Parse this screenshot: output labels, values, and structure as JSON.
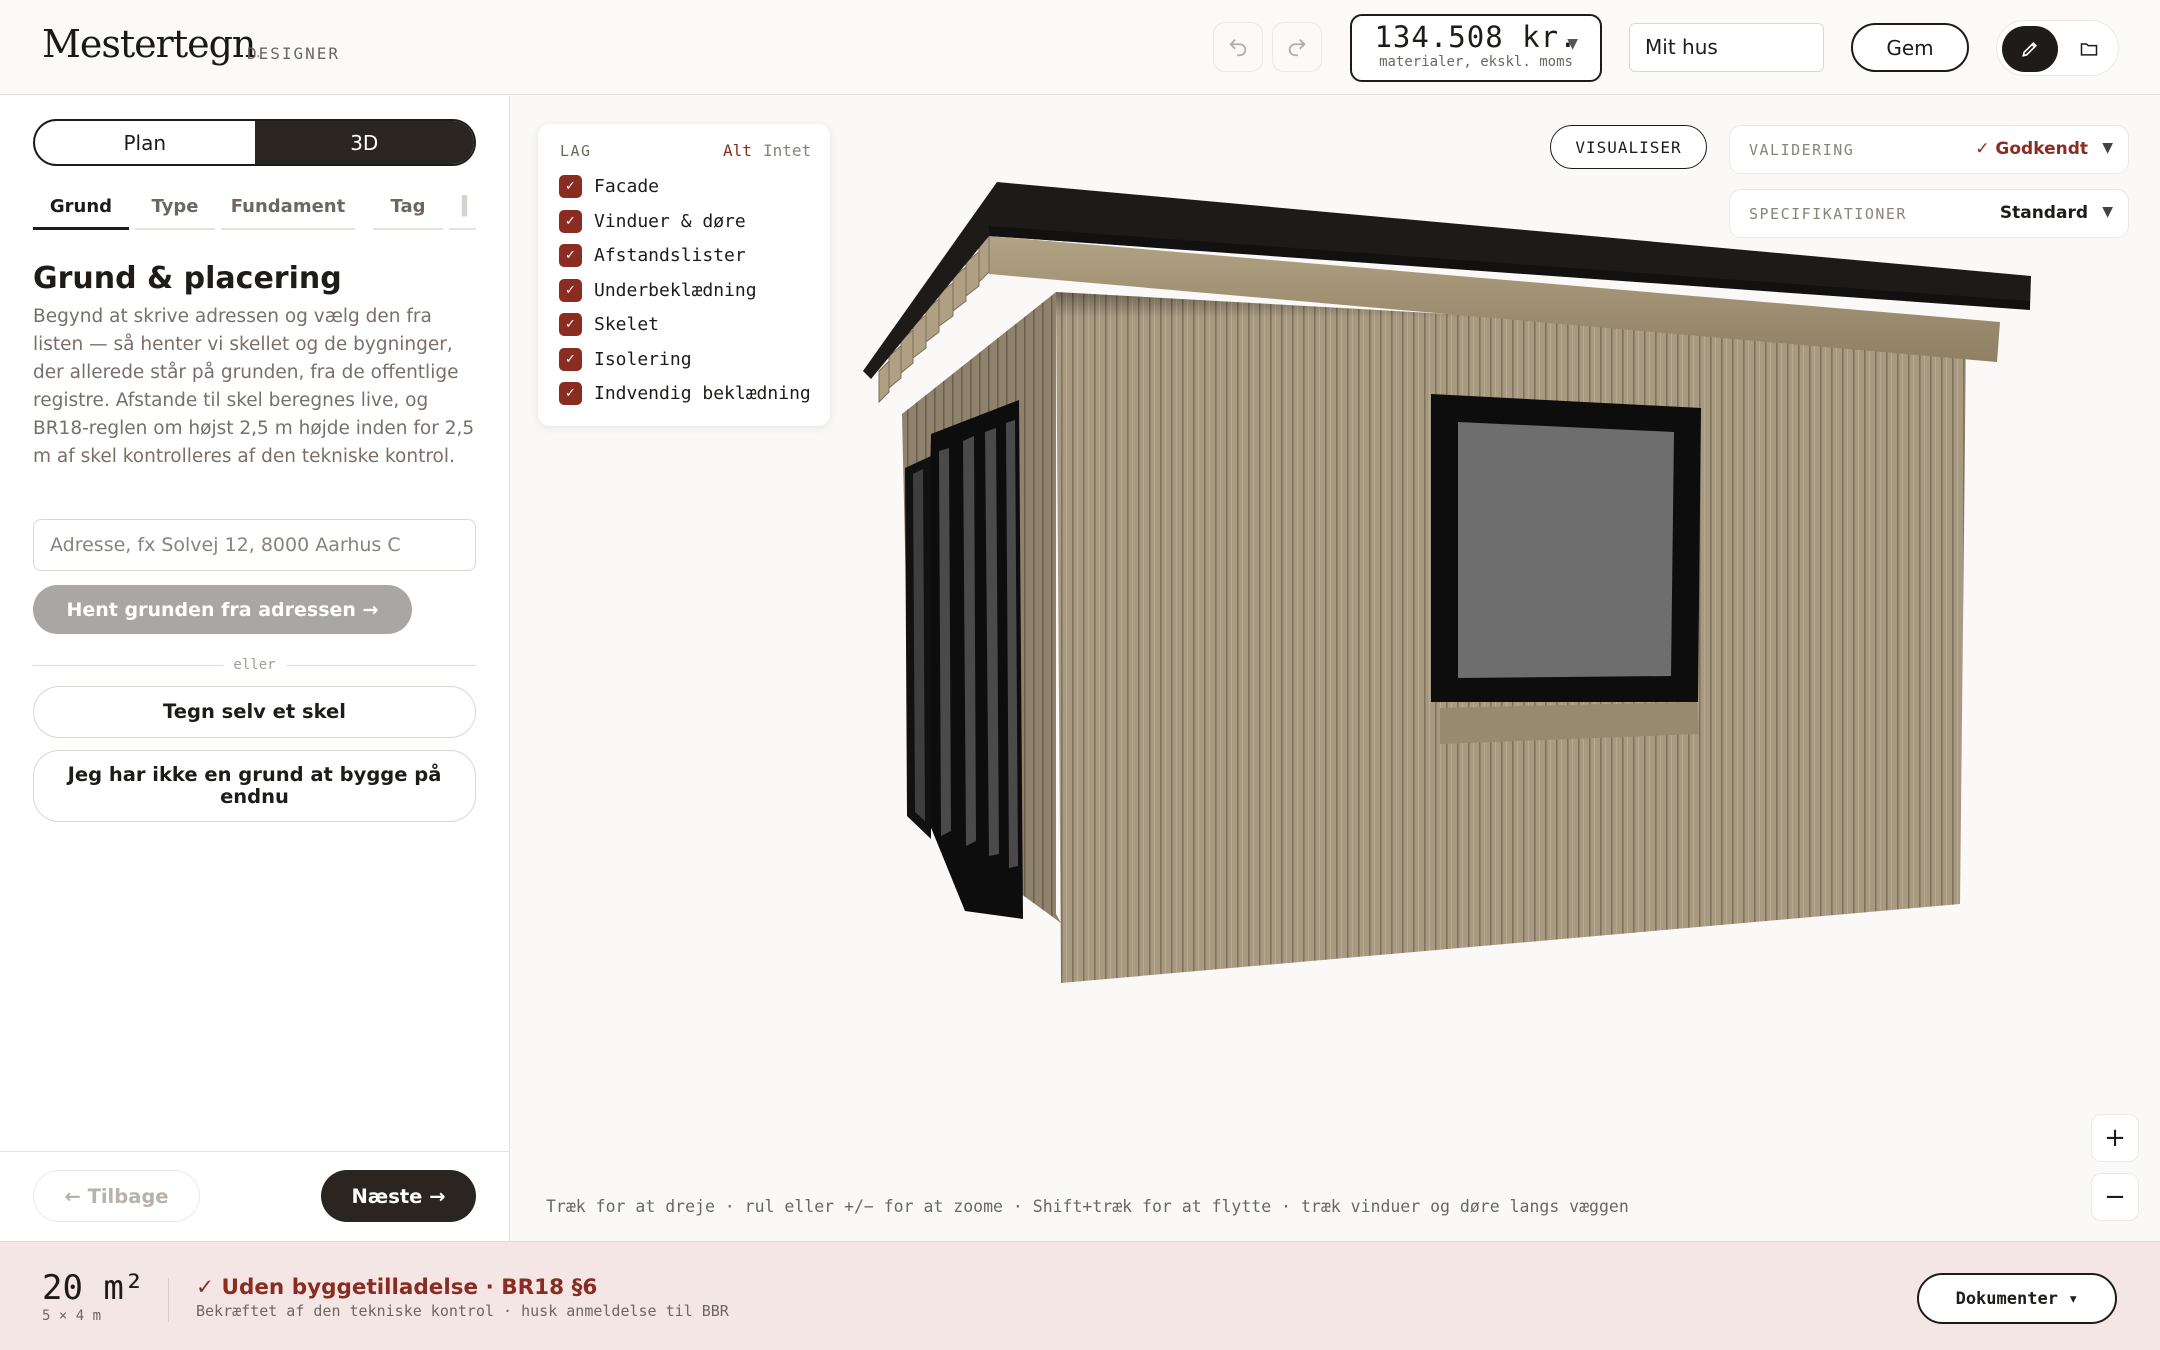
{
  "app": {
    "name": "Mestertegn",
    "tagline": "DESIGNER"
  },
  "header": {
    "undo_icon": "undo-icon",
    "redo_icon": "redo-icon",
    "price": {
      "value": "134.508 kr.",
      "caption": "materialer, ekskl. moms"
    },
    "project_name": "Mit hus",
    "save_label": "Gem",
    "mode_icons": [
      "pencil-icon",
      "folder-icon"
    ]
  },
  "sidebar": {
    "view_toggle": {
      "plan": "Plan",
      "three_d": "3D",
      "active": "3D"
    },
    "tabs": [
      "Grund",
      "Type",
      "Fundament",
      "Tag"
    ],
    "active_tab": "Grund",
    "section_title": "Grund & placering",
    "section_description": "Begynd at skrive adressen og vælg den fra listen — så henter vi skellet og de bygninger, der allerede står på grunden, fra de offentlige registre. Afstande til skel beregnes live, og BR18-reglen om højst 2,5 m højde inden for 2,5 m af skel kontrolleres af den tekniske kontrol.",
    "address_placeholder": "Adresse, fx Solvej 12, 8000 Aarhus C",
    "fetch_button": "Hent grunden fra adressen →",
    "or_label": "eller",
    "draw_button": "Tegn selv et skel",
    "no_plot_button": "Jeg har ikke en grund at bygge på endnu",
    "back_button": "← Tilbage",
    "next_button": "Næste →"
  },
  "viewport": {
    "layers": {
      "title": "LAG",
      "all": "Alt",
      "none": "Intet",
      "items": [
        {
          "label": "Facade",
          "checked": true
        },
        {
          "label": "Vinduer & døre",
          "checked": true
        },
        {
          "label": "Afstandslister",
          "checked": true
        },
        {
          "label": "Underbeklædning",
          "checked": true
        },
        {
          "label": "Skelet",
          "checked": true
        },
        {
          "label": "Isolering",
          "checked": true
        },
        {
          "label": "Indvendig beklædning",
          "checked": true
        }
      ]
    },
    "visualise_button": "VISUALISER",
    "validation": {
      "label": "VALIDERING",
      "value": "✓ Godkendt"
    },
    "specifications": {
      "label": "SPECIFIKATIONER",
      "value": "Standard"
    },
    "zoom_in": "+",
    "zoom_out": "−",
    "hint": "Træk for at dreje · rul eller +/− for at zoome · Shift+træk for at flytte · træk vinduer og døre langs væggen"
  },
  "footer": {
    "area": "20 m²",
    "dimensions": "5 × 4 m",
    "permit_title": "✓ Uden byggetilladelse · BR18 §6",
    "permit_subtitle": "Bekræftet af den tekniske kontrol · husk anmeldelse til BBR",
    "documents_button": "Dokumenter ▾"
  },
  "colors": {
    "accent": "#8a2c22",
    "dark": "#1e1b19",
    "footer_bg": "#f3e6e4",
    "cladding": "#a89a80"
  }
}
